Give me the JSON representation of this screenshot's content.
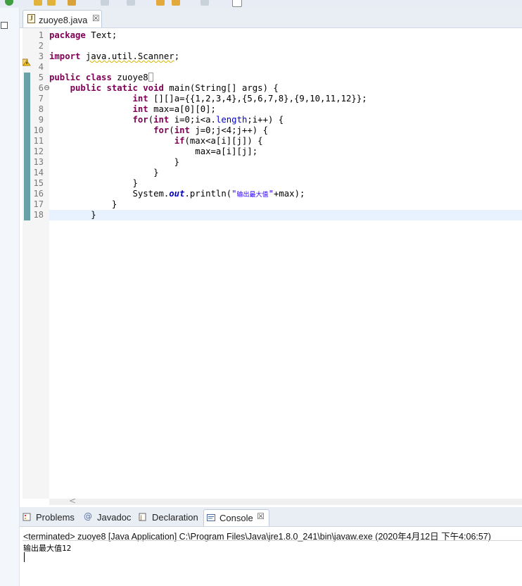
{
  "editor": {
    "tab_label": "zuoye8.java",
    "tab_close": "☒",
    "lines": [
      {
        "n": "1",
        "tokens": [
          [
            "kw",
            "package"
          ],
          [
            "plain",
            " Text;"
          ]
        ]
      },
      {
        "n": "2",
        "tokens": []
      },
      {
        "n": "3",
        "tokens": [
          [
            "kw",
            "import"
          ],
          [
            "plain",
            " "
          ],
          [
            "warn",
            "java.util.Scanner"
          ],
          [
            "plain",
            ";"
          ]
        ]
      },
      {
        "n": "4",
        "tokens": []
      },
      {
        "n": "5",
        "tokens": [
          [
            "kw",
            "public"
          ],
          [
            "plain",
            " "
          ],
          [
            "kw",
            "class"
          ],
          [
            "plain",
            " zuoye8"
          ],
          [
            "cursor",
            ""
          ]
        ]
      },
      {
        "n": "6",
        "tokens": [
          [
            "plain",
            "    "
          ],
          [
            "kw",
            "public"
          ],
          [
            "plain",
            " "
          ],
          [
            "kw",
            "static"
          ],
          [
            "plain",
            " "
          ],
          [
            "kw",
            "void"
          ],
          [
            "plain",
            " main(String[] "
          ],
          [
            "plain",
            "args) {"
          ]
        ],
        "fold": "−"
      },
      {
        "n": "7",
        "tokens": [
          [
            "plain",
            "                "
          ],
          [
            "kw",
            "int"
          ],
          [
            "plain",
            " [][]a={{1,2,3,4},{5,6,7,8},{9,10,11,12}};"
          ]
        ]
      },
      {
        "n": "8",
        "tokens": [
          [
            "plain",
            "                "
          ],
          [
            "kw",
            "int"
          ],
          [
            "plain",
            " max=a[0][0];"
          ]
        ]
      },
      {
        "n": "9",
        "tokens": [
          [
            "plain",
            "                "
          ],
          [
            "kw",
            "for"
          ],
          [
            "plain",
            "("
          ],
          [
            "kw",
            "int"
          ],
          [
            "plain",
            " i=0;i<a."
          ],
          [
            "fld",
            "length"
          ],
          [
            "plain",
            ";i++) {"
          ]
        ]
      },
      {
        "n": "10",
        "tokens": [
          [
            "plain",
            "                    "
          ],
          [
            "kw",
            "for"
          ],
          [
            "plain",
            "("
          ],
          [
            "kw",
            "int"
          ],
          [
            "plain",
            " j=0;j<4;j++) {"
          ]
        ]
      },
      {
        "n": "11",
        "tokens": [
          [
            "plain",
            "                        "
          ],
          [
            "kw",
            "if"
          ],
          [
            "plain",
            "(max<a[i][j]) {"
          ]
        ]
      },
      {
        "n": "12",
        "tokens": [
          [
            "plain",
            "                            max=a[i][j];"
          ]
        ]
      },
      {
        "n": "13",
        "tokens": [
          [
            "plain",
            "                        }"
          ]
        ]
      },
      {
        "n": "14",
        "tokens": [
          [
            "plain",
            "                    }"
          ]
        ]
      },
      {
        "n": "15",
        "tokens": [
          [
            "plain",
            "                }"
          ]
        ]
      },
      {
        "n": "16",
        "tokens": [
          [
            "plain",
            "                System."
          ],
          [
            "sfld",
            "out"
          ],
          [
            "plain",
            ".println("
          ],
          [
            "str",
            "\""
          ],
          [
            "strs",
            "输出最大值"
          ],
          [
            "str",
            "\""
          ],
          [
            "plain",
            "+max);"
          ]
        ]
      },
      {
        "n": "17",
        "tokens": [
          [
            "plain",
            "            }"
          ]
        ]
      },
      {
        "n": "18",
        "tokens": [
          [
            "plain",
            "        }"
          ]
        ]
      }
    ],
    "scroll_left_glyph": "<"
  },
  "panel": {
    "tabs": [
      {
        "label": "Problems",
        "icon": "problems-icon"
      },
      {
        "label": "Javadoc",
        "icon": "javadoc-icon"
      },
      {
        "label": "Declaration",
        "icon": "declaration-icon"
      },
      {
        "label": "Console",
        "icon": "console-icon"
      }
    ],
    "console_close": "☒",
    "status": "<terminated> zuoye8 [Java Application] C:\\Program Files\\Java\\jre1.8.0_241\\bin\\javaw.exe (2020年4月12日 下午4:06:57)",
    "output": "输出最大值12"
  },
  "colors": {
    "keyword": "#7f0055",
    "string": "#2a00ff",
    "field": "#0000c0",
    "current_line": "#e8f2fe",
    "ruler_mark": "#69a2a6"
  }
}
